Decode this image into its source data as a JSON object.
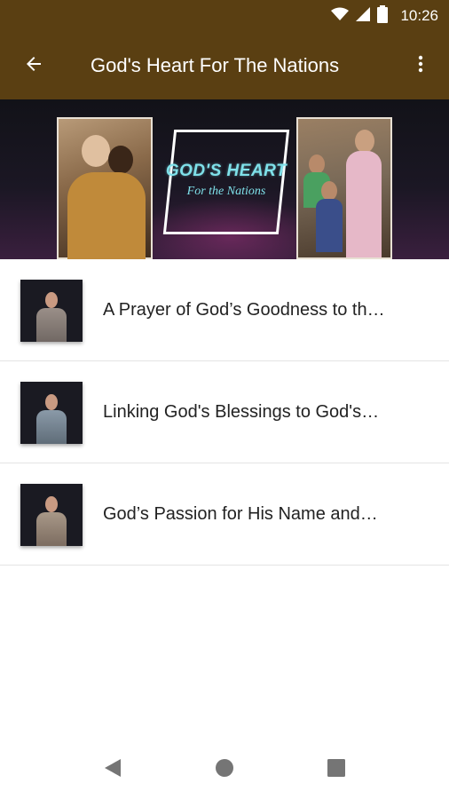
{
  "status_bar": {
    "time": "10:26",
    "icons": [
      "wifi-icon",
      "cell-signal-icon",
      "battery-icon"
    ]
  },
  "app_bar": {
    "title": "God's Heart For The Nations",
    "back_icon": "arrow-back-icon",
    "menu_icon": "more-vert-icon",
    "background_color": "#5a3f12"
  },
  "banner": {
    "title": "GOD'S HEART",
    "subtitle": "For the Nations",
    "accent_color": "#7fe1ea"
  },
  "items": [
    {
      "title": "A Prayer of God’s Goodness to th…"
    },
    {
      "title": "Linking God's Blessings to God's…"
    },
    {
      "title": "God’s Passion for His Name and…"
    }
  ],
  "nav_bar": {
    "icons": [
      "back-triangle-icon",
      "home-circle-icon",
      "recents-square-icon"
    ]
  }
}
